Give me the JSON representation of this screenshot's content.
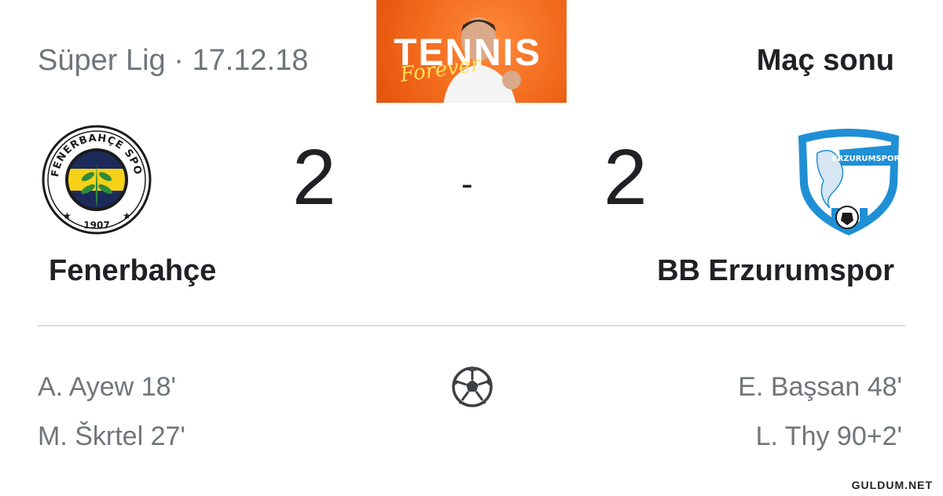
{
  "header": {
    "league_date": "Süper Lig · 17.12.18",
    "status": "Maç sonu"
  },
  "ad": {
    "headline": "TENNIS",
    "script": "Forever",
    "colors": {
      "background": "#f26a1c",
      "script": "#ffe25a"
    }
  },
  "match": {
    "home": {
      "name": "Fenerbahçe",
      "score": "2",
      "logo_text": "FENERBAHÇE SPOR KULÜBÜ",
      "logo_year": "1907"
    },
    "away": {
      "name": "BB Erzurumspor",
      "score": "2",
      "logo_text": "ERZURUMSPOR"
    },
    "separator": "-"
  },
  "goals": {
    "icon": "soccer-ball-icon",
    "home": [
      "A. Ayew 18'",
      "M. Škrtel 27'"
    ],
    "away": [
      "E. Başsan 48'",
      "L. Thy 90+2'"
    ]
  },
  "watermark": "GULDUM.NET",
  "colors": {
    "primary_text": "#202124",
    "secondary_text": "#70757a",
    "divider": "#dadce0",
    "fb_navy": "#1b2a5a",
    "fb_yellow": "#f7d117",
    "erz_blue": "#1f8fd6"
  }
}
